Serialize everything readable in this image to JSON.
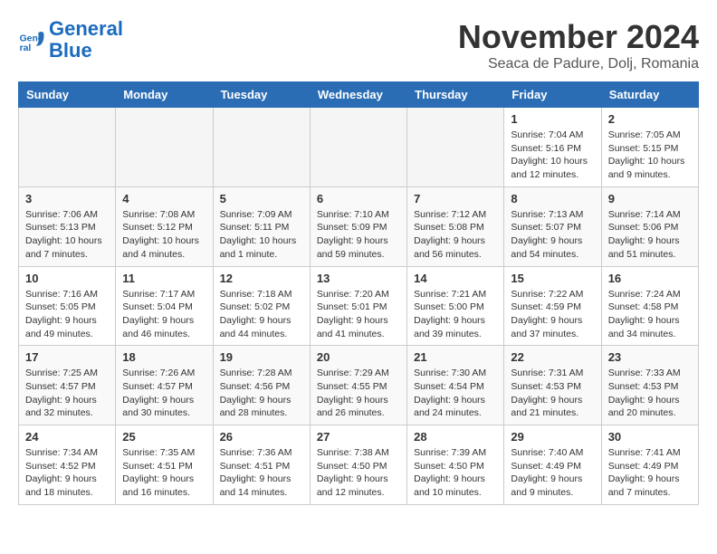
{
  "header": {
    "logo_line1": "General",
    "logo_line2": "Blue",
    "month": "November 2024",
    "location": "Seaca de Padure, Dolj, Romania"
  },
  "days_of_week": [
    "Sunday",
    "Monday",
    "Tuesday",
    "Wednesday",
    "Thursday",
    "Friday",
    "Saturday"
  ],
  "weeks": [
    [
      {
        "day": "",
        "info": ""
      },
      {
        "day": "",
        "info": ""
      },
      {
        "day": "",
        "info": ""
      },
      {
        "day": "",
        "info": ""
      },
      {
        "day": "",
        "info": ""
      },
      {
        "day": "1",
        "info": "Sunrise: 7:04 AM\nSunset: 5:16 PM\nDaylight: 10 hours and 12 minutes."
      },
      {
        "day": "2",
        "info": "Sunrise: 7:05 AM\nSunset: 5:15 PM\nDaylight: 10 hours and 9 minutes."
      }
    ],
    [
      {
        "day": "3",
        "info": "Sunrise: 7:06 AM\nSunset: 5:13 PM\nDaylight: 10 hours and 7 minutes."
      },
      {
        "day": "4",
        "info": "Sunrise: 7:08 AM\nSunset: 5:12 PM\nDaylight: 10 hours and 4 minutes."
      },
      {
        "day": "5",
        "info": "Sunrise: 7:09 AM\nSunset: 5:11 PM\nDaylight: 10 hours and 1 minute."
      },
      {
        "day": "6",
        "info": "Sunrise: 7:10 AM\nSunset: 5:09 PM\nDaylight: 9 hours and 59 minutes."
      },
      {
        "day": "7",
        "info": "Sunrise: 7:12 AM\nSunset: 5:08 PM\nDaylight: 9 hours and 56 minutes."
      },
      {
        "day": "8",
        "info": "Sunrise: 7:13 AM\nSunset: 5:07 PM\nDaylight: 9 hours and 54 minutes."
      },
      {
        "day": "9",
        "info": "Sunrise: 7:14 AM\nSunset: 5:06 PM\nDaylight: 9 hours and 51 minutes."
      }
    ],
    [
      {
        "day": "10",
        "info": "Sunrise: 7:16 AM\nSunset: 5:05 PM\nDaylight: 9 hours and 49 minutes."
      },
      {
        "day": "11",
        "info": "Sunrise: 7:17 AM\nSunset: 5:04 PM\nDaylight: 9 hours and 46 minutes."
      },
      {
        "day": "12",
        "info": "Sunrise: 7:18 AM\nSunset: 5:02 PM\nDaylight: 9 hours and 44 minutes."
      },
      {
        "day": "13",
        "info": "Sunrise: 7:20 AM\nSunset: 5:01 PM\nDaylight: 9 hours and 41 minutes."
      },
      {
        "day": "14",
        "info": "Sunrise: 7:21 AM\nSunset: 5:00 PM\nDaylight: 9 hours and 39 minutes."
      },
      {
        "day": "15",
        "info": "Sunrise: 7:22 AM\nSunset: 4:59 PM\nDaylight: 9 hours and 37 minutes."
      },
      {
        "day": "16",
        "info": "Sunrise: 7:24 AM\nSunset: 4:58 PM\nDaylight: 9 hours and 34 minutes."
      }
    ],
    [
      {
        "day": "17",
        "info": "Sunrise: 7:25 AM\nSunset: 4:57 PM\nDaylight: 9 hours and 32 minutes."
      },
      {
        "day": "18",
        "info": "Sunrise: 7:26 AM\nSunset: 4:57 PM\nDaylight: 9 hours and 30 minutes."
      },
      {
        "day": "19",
        "info": "Sunrise: 7:28 AM\nSunset: 4:56 PM\nDaylight: 9 hours and 28 minutes."
      },
      {
        "day": "20",
        "info": "Sunrise: 7:29 AM\nSunset: 4:55 PM\nDaylight: 9 hours and 26 minutes."
      },
      {
        "day": "21",
        "info": "Sunrise: 7:30 AM\nSunset: 4:54 PM\nDaylight: 9 hours and 24 minutes."
      },
      {
        "day": "22",
        "info": "Sunrise: 7:31 AM\nSunset: 4:53 PM\nDaylight: 9 hours and 21 minutes."
      },
      {
        "day": "23",
        "info": "Sunrise: 7:33 AM\nSunset: 4:53 PM\nDaylight: 9 hours and 20 minutes."
      }
    ],
    [
      {
        "day": "24",
        "info": "Sunrise: 7:34 AM\nSunset: 4:52 PM\nDaylight: 9 hours and 18 minutes."
      },
      {
        "day": "25",
        "info": "Sunrise: 7:35 AM\nSunset: 4:51 PM\nDaylight: 9 hours and 16 minutes."
      },
      {
        "day": "26",
        "info": "Sunrise: 7:36 AM\nSunset: 4:51 PM\nDaylight: 9 hours and 14 minutes."
      },
      {
        "day": "27",
        "info": "Sunrise: 7:38 AM\nSunset: 4:50 PM\nDaylight: 9 hours and 12 minutes."
      },
      {
        "day": "28",
        "info": "Sunrise: 7:39 AM\nSunset: 4:50 PM\nDaylight: 9 hours and 10 minutes."
      },
      {
        "day": "29",
        "info": "Sunrise: 7:40 AM\nSunset: 4:49 PM\nDaylight: 9 hours and 9 minutes."
      },
      {
        "day": "30",
        "info": "Sunrise: 7:41 AM\nSunset: 4:49 PM\nDaylight: 9 hours and 7 minutes."
      }
    ]
  ]
}
